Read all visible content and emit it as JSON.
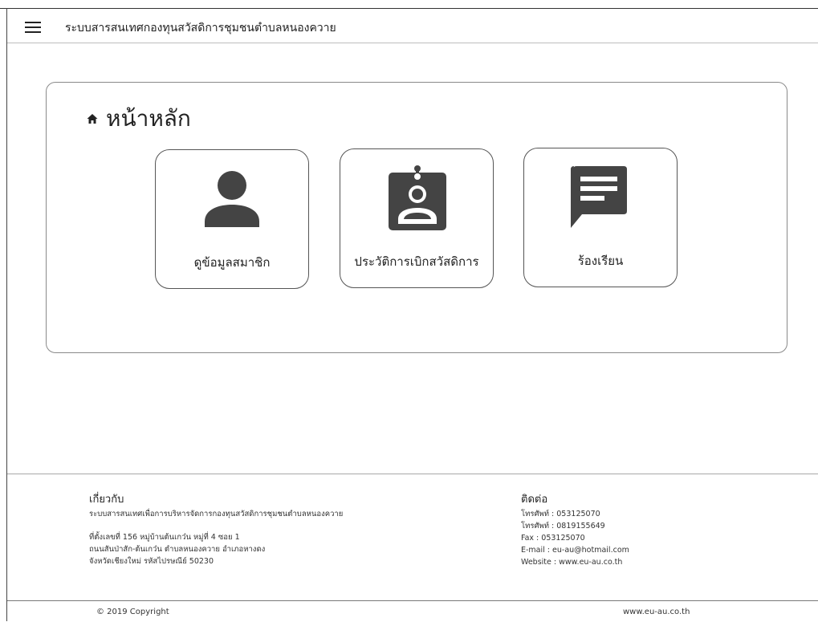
{
  "header": {
    "title": "ระบบสารสนเทศกองทุนสวัสดิการชุมชนตำบลหนองควาย",
    "menu_icon": "hamburger-icon"
  },
  "main": {
    "title": "หน้าหลัก",
    "title_icon": "home-icon",
    "tiles": [
      {
        "label": "ดูข้อมูลสมาชิก",
        "icon": "person-icon"
      },
      {
        "label": "ประวัติการเบิกสวัสดิการ",
        "icon": "badge-icon"
      },
      {
        "label": "ร้องเรียน",
        "icon": "message-icon"
      }
    ]
  },
  "footer": {
    "about": {
      "title": "เกี่ยวกับ",
      "desc": "ระบบสารสนเทศเพื่อการบริหารจัดการกองทุนสวัสดิการชุมชนตำบลหนองควาย",
      "address": [
        "ที่ตั้งเลขที่ 156 หมู่บ้านต้นเกว๋น หมู่ที่ 4 ซอย 1",
        "ถนนสันป่าสัก-ต้นเกว๋น ตำบลหนองควาย อำเภอหางดง",
        "จังหวัดเชียงใหม่ รหัสไปรษณีย์ 50230"
      ]
    },
    "contact": {
      "title": "ติดต่อ",
      "lines": [
        "โทรศัพท์ : 053125070",
        "โทรศัพท์ : 0819155649",
        "Fax : 053125070",
        "E-mail : eu-au@hotmail.com",
        "Website : www.eu-au.co.th"
      ]
    },
    "copyright": "© 2019 Copyright",
    "site": "www.eu-au.co.th"
  },
  "colors": {
    "icon": "#444444",
    "border": "#555555",
    "text": "#222222"
  }
}
